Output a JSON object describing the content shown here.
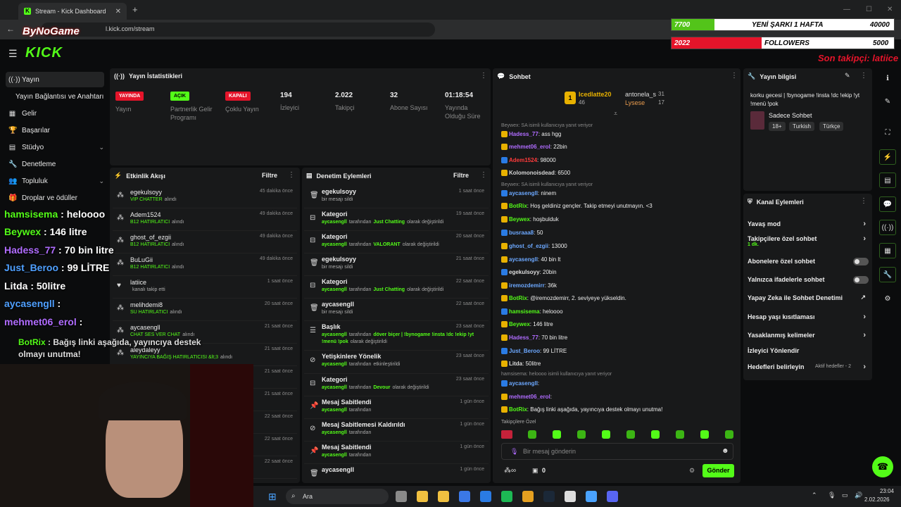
{
  "browser": {
    "tab_title": "Stream - Kick Dashboard",
    "url": "dashboard.kick.com/stream",
    "url_visible": "l.kick.com/stream",
    "new_tab": "+",
    "close": "✕"
  },
  "overlay": {
    "logo": "ByNoGame",
    "bar1_left": "7700",
    "bar1_title": "YENİ ŞARKI 1 HAFTA",
    "bar1_right": "40000",
    "bar1_progress": 0.1925,
    "bar2_left": "2022",
    "bar2_title": "FOLLOWERS",
    "bar2_right": "5000",
    "bar2_progress": 0.4044,
    "last_follower": "Son takipçi: latiice"
  },
  "kick": {
    "logo": "KICK"
  },
  "sidebar": {
    "items": [
      {
        "label": "Yayın",
        "icon": "broadcast-icon"
      },
      {
        "label": "Yayın Bağlantısı ve Anahtarı",
        "icon": ""
      },
      {
        "label": "Gelir",
        "icon": "revenue-icon"
      },
      {
        "label": "Başarılar",
        "icon": "trophy-icon"
      },
      {
        "label": "Stüdyo",
        "icon": "studio-icon"
      },
      {
        "label": "Denetleme",
        "icon": "wrench-icon"
      },
      {
        "label": "Topluluk",
        "icon": "community-icon"
      },
      {
        "label": "Droplar ve ödüller",
        "icon": "drops-icon"
      }
    ]
  },
  "stats": {
    "title": "Yayın İstatistikleri",
    "cols": [
      {
        "badge": "YAYINDA",
        "label": "Yayın"
      },
      {
        "badge": "AÇIK",
        "label": "Partnerlik Gelir Programı"
      },
      {
        "badge": "KAPALI",
        "label": "Çoklu Yayın"
      },
      {
        "value": "194",
        "label": "İzleyici"
      },
      {
        "value": "2.022",
        "label": "Takipçi"
      },
      {
        "value": "32",
        "label": "Abone Sayısı"
      },
      {
        "value": "01:18:54",
        "label": "Yayında Olduğu Süre"
      }
    ]
  },
  "activity": {
    "title": "Etkinlik Akışı",
    "filter": "Filtre",
    "rows": [
      {
        "name": "egekulsoyy",
        "sub": "VIP CHATTER",
        "suffix": "alındı",
        "time": "45 dakika önce"
      },
      {
        "name": "Adem1524",
        "sub": "B12 HATIRLATICI",
        "suffix": "alındı",
        "time": "49 dakika önce"
      },
      {
        "name": "ghost_of_ezgii",
        "sub": "B12 HATIRLATICI",
        "suffix": "alındı",
        "time": "49 dakika önce"
      },
      {
        "name": "BuLuGii",
        "sub": "B12 HATIRLATICI",
        "suffix": "alındı",
        "time": "49 dakika önce"
      },
      {
        "name": "latiice",
        "sub": "",
        "suffix": "kanalı takip etti",
        "time": "1 saat önce"
      },
      {
        "name": "melihdemi8",
        "sub": "SU HATIRLATICI",
        "suffix": "alındı",
        "time": "20 saat önce"
      },
      {
        "name": "aycasengll",
        "sub": "CHAT SES VER CHAT",
        "suffix": "alındı",
        "time": "21 saat önce"
      },
      {
        "name": "aleydaleyy",
        "sub": "YAYINCIYA BAĞIŞ HATIRLATICISI &lt;3",
        "suffix": "alındı",
        "time": "21 saat önce"
      },
      {
        "name": "",
        "sub": "",
        "suffix": "",
        "time": "21 saat önce"
      },
      {
        "name": "",
        "sub": "",
        "suffix": "",
        "time": "21 saat önce"
      },
      {
        "name": "",
        "sub": "",
        "suffix": "",
        "time": "22 saat önce"
      },
      {
        "name": "",
        "sub": "",
        "suffix": "",
        "time": "22 saat önce"
      },
      {
        "name": "",
        "sub": "",
        "suffix": "",
        "time": "22 saat önce"
      }
    ]
  },
  "moderation": {
    "title": "Denetim Eylemleri",
    "filter": "Filtre",
    "rows": [
      {
        "name": "egekulsoyy",
        "pre": "",
        "hl": "",
        "post": "bir mesajı sildi",
        "time": "1 saat önce"
      },
      {
        "name": "Kategori",
        "pre": "aycasengll",
        "hl": "Just Chatting",
        "post": "olarak değiştirildi",
        "time": "19 saat önce"
      },
      {
        "name": "Kategori",
        "pre": "aycasengll",
        "hl": "VALORANT",
        "post": "olarak değiştirildi",
        "time": "20 saat önce"
      },
      {
        "name": "egekulsoyy",
        "pre": "",
        "hl": "",
        "post": "bir mesajı sildi",
        "time": "21 saat önce"
      },
      {
        "name": "Kategori",
        "pre": "aycasengll",
        "hl": "Just Chatting",
        "post": "olarak değiştirildi",
        "time": "22 saat önce"
      },
      {
        "name": "aycasengll",
        "pre": "",
        "hl": "",
        "post": "bir mesajı sildi",
        "time": "22 saat önce"
      },
      {
        "name": "Başlık",
        "pre": "aycasengll",
        "hl": "döver biçer | !bynogame !insta !dc !ekip !yt !menü !pok",
        "post": "olarak değiştirildi",
        "time": "23 saat önce"
      },
      {
        "name": "Yetişkinlere Yönelik",
        "pre": "aycasengll",
        "hl": "",
        "post": "etkinleştirildi",
        "time": "23 saat önce"
      },
      {
        "name": "Kategori",
        "pre": "aycasengll",
        "hl": "Devour",
        "post": "olarak değiştirildi",
        "time": "23 saat önce"
      },
      {
        "name": "Mesaj Sabitlendi",
        "pre": "aycasengll",
        "hl": "",
        "post": "",
        "time": "1 gün önce"
      },
      {
        "name": "Mesaj Sabitlemesi Kaldırıldı",
        "pre": "aycasengll",
        "hl": "",
        "post": "",
        "time": "1 gün önce"
      },
      {
        "name": "Mesaj Sabitlendi",
        "pre": "aycasengll",
        "hl": "",
        "post": "",
        "time": "1 gün önce"
      },
      {
        "name": "aycasengll",
        "pre": "",
        "hl": "",
        "post": "",
        "time": "1 gün önce"
      }
    ],
    "by": "tarafından"
  },
  "chat": {
    "title": "Sohbet",
    "top": [
      {
        "name": "Icedlatte20",
        "count": "46"
      },
      {
        "name": "antonela_s",
        "count": "31"
      },
      {
        "name": "Lysese",
        "count": "17"
      }
    ],
    "rank1": "1",
    "lines": [
      {
        "reply": "Beywex: SA isimli kullanıcıya yanıt veriyor"
      },
      {
        "user": "Hadess_77",
        "color": "#b06cff",
        "text": "ass hgg"
      },
      {
        "user": "mehmet06_erol",
        "color": "#b06cff",
        "text": "22bin"
      },
      {
        "user": "Adem1524",
        "color": "#ff3b3b",
        "text": "98000"
      },
      {
        "user": "Kolomonoisdead",
        "color": "#d6d6d6",
        "text": "6500"
      },
      {
        "reply": "Beywex: SA isimli kullanıcıya yanıt veriyor"
      },
      {
        "user": "aycasengll",
        "color": "#6ca8ff",
        "text": "ninem"
      },
      {
        "user": "BotRix",
        "color": "#53fc18",
        "text": "Hoş geldiniz gençler. Takip etmeyi unutmayın. <3"
      },
      {
        "user": "Beywex",
        "color": "#53fc18",
        "text": "hoşbulduk"
      },
      {
        "user": "busraaa8",
        "color": "#6ca8ff",
        "text": "50"
      },
      {
        "user": "ghost_of_ezgii",
        "color": "#6ca8ff",
        "text": "13000"
      },
      {
        "user": "aycasengll",
        "color": "#6ca8ff",
        "text": "40 bin lt"
      },
      {
        "user": "egekulsoyy",
        "color": "#ddd",
        "text": "20bin"
      },
      {
        "user": "iremozdemirr",
        "color": "#6ca8ff",
        "text": "36k"
      },
      {
        "user": "BotRix",
        "color": "#53fc18",
        "text": "@iremozdemirr, 2. seviyeye yükseldin."
      },
      {
        "user": "hamsisema",
        "color": "#53fc18",
        "text": "heloooo"
      },
      {
        "user": "Beywex",
        "color": "#53fc18",
        "text": "146 litre"
      },
      {
        "user": "Hadess_77",
        "color": "#b06cff",
        "text": "70 bin litre"
      },
      {
        "user": "Just_Beroo",
        "color": "#6ca8ff",
        "text": "99 LİTRE"
      },
      {
        "user": "Litda",
        "color": "#ddd",
        "text": "50litre"
      },
      {
        "reply": "hamsisema: heloooo isimli kullanıcıya yanıt veriyor"
      },
      {
        "user": "aycasengll",
        "color": "#6ca8ff",
        "text": ""
      },
      {
        "user": "mehmet06_erol",
        "color": "#b06cff",
        "text": ""
      },
      {
        "user": "BotRix",
        "color": "#53fc18",
        "text": "Bağış linki aşağıda, yayıncıya destek olmayı unutma!"
      }
    ],
    "emote_label": "Takipçilere Özel",
    "input_placeholder": "Bir mesaj gönderin",
    "points": "0",
    "send": "Gönder"
  },
  "info": {
    "title": "Yayın bilgisi",
    "stream_title": "korku gecesi | !bynogame !insta !dc !ekip !yt !menü !pok",
    "category": "Sadece Sohbet",
    "tags": [
      "18+",
      "Turkish",
      "Türkçe"
    ]
  },
  "channel_actions": {
    "title": "Kanal Eylemleri",
    "rows": [
      {
        "label": "Yavaş mod",
        "kind": "chev"
      },
      {
        "label": "Takipçilere özel sohbet",
        "sub": "1 dk.",
        "kind": "chev"
      },
      {
        "label": "Abonelere özel sohbet",
        "kind": "toggle"
      },
      {
        "label": "Yalnızca ifadelerle sohbet",
        "kind": "toggle"
      },
      {
        "label": "Yapay Zeka ile Sohbet Denetimi",
        "kind": "ext"
      },
      {
        "label": "Hesap yaşı kısıtlaması",
        "kind": "chev"
      },
      {
        "label": "Yasaklanmış kelimeler",
        "kind": "chev"
      },
      {
        "label": "İzleyici Yönlendir",
        "kind": "none"
      },
      {
        "label": "Hedefleri belirleyin",
        "extra": "Aktif hedefler - 2",
        "kind": "chev"
      }
    ]
  },
  "bigchat": [
    {
      "user": "hamsisema",
      "text": " : heloooo",
      "color": "#53fc18"
    },
    {
      "user": "Beywex",
      "text": " : 146 litre",
      "color": "#53fc18"
    },
    {
      "user": "Hadess_77",
      "text": " : 70 bin litre",
      "color": "#b06cff"
    },
    {
      "user": "Just_Beroo",
      "text": " : 99 LİTRE",
      "color": "#4fa0ff"
    },
    {
      "user": "Litda",
      "text": " : 50litre",
      "color": "#ffffff"
    },
    {
      "user": "aycasengll",
      "text": " :",
      "color": "#4fa0ff"
    },
    {
      "user": "mehmet06_erol",
      "text": " :",
      "color": "#b06cff"
    }
  ],
  "bigchat_bot": {
    "user": "BotRix",
    "text": ": Bağış linki aşağıda, yayıncıya destek olmayı unutma!"
  },
  "taskbar": {
    "search": "Ara",
    "time": "23:04",
    "date": "2.02.2026"
  }
}
